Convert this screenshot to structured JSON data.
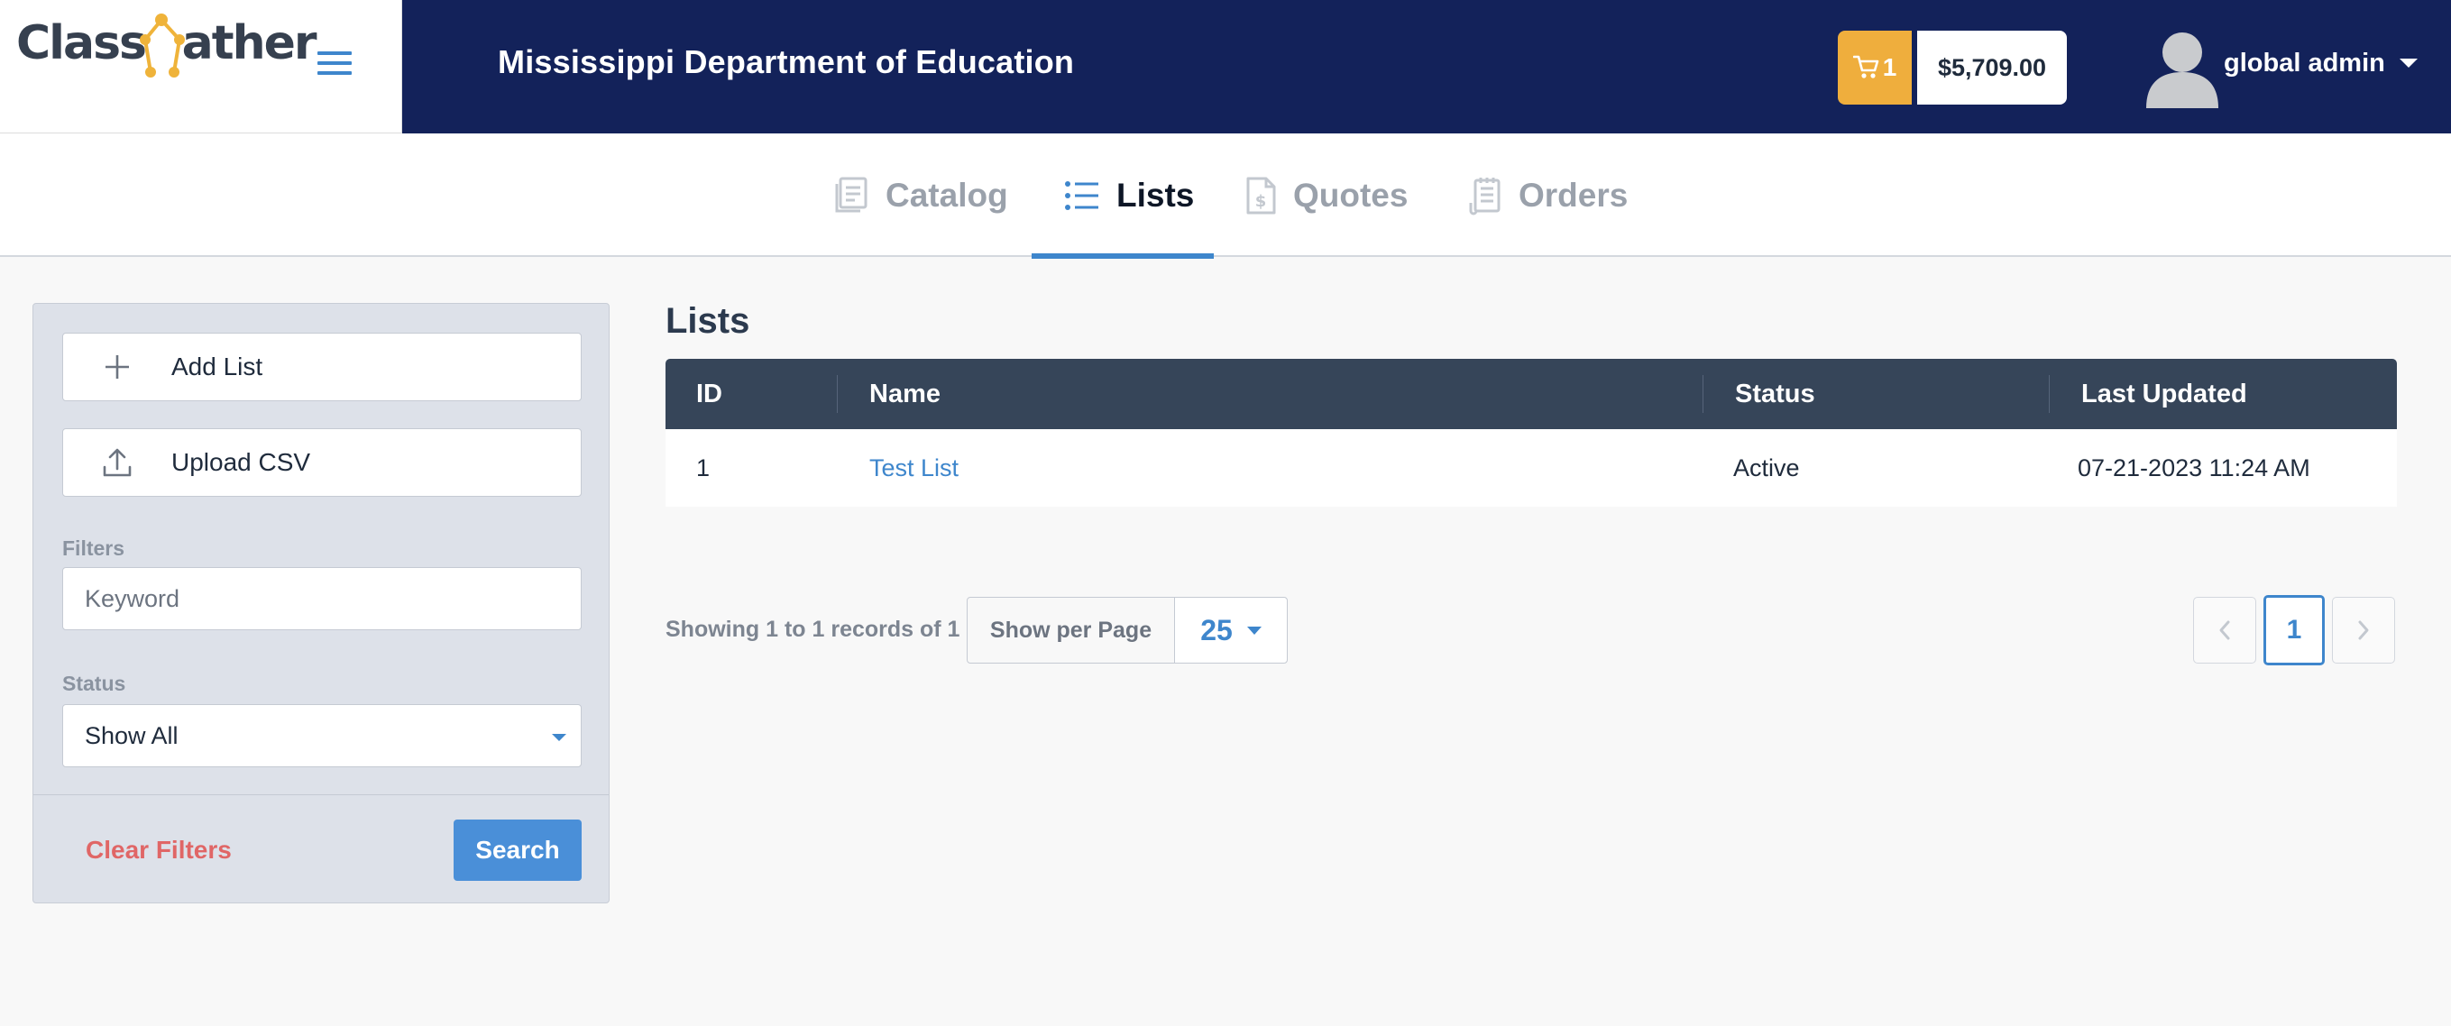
{
  "brand": {
    "logo_text_left": "Class",
    "logo_text_g": "G",
    "logo_text_right": "ather",
    "accent_color": "#efb33a",
    "header_bg": "#13225a"
  },
  "header": {
    "org_name": "Mississippi Department of Education",
    "cart_count": "1",
    "cart_total": "$5,709.00",
    "user_name": "global admin"
  },
  "nav": {
    "tabs": [
      {
        "label": "Catalog",
        "icon": "catalog-icon",
        "active": false
      },
      {
        "label": "Lists",
        "icon": "list-icon",
        "active": true
      },
      {
        "label": "Quotes",
        "icon": "quote-icon",
        "active": false
      },
      {
        "label": "Orders",
        "icon": "orders-icon",
        "active": false
      }
    ]
  },
  "sidebar": {
    "add_list_label": "Add List",
    "upload_csv_label": "Upload CSV",
    "filters_label": "Filters",
    "keyword_placeholder": "Keyword",
    "status_label": "Status",
    "status_selected": "Show All",
    "clear_filters_label": "Clear Filters",
    "search_label": "Search"
  },
  "main": {
    "title": "Lists",
    "columns": [
      "ID",
      "Name",
      "Status",
      "Last Updated"
    ],
    "rows": [
      {
        "id": "1",
        "name": "Test List",
        "status": "Active",
        "last_updated": "07-21-2023 11:24 AM"
      }
    ],
    "showing_text": "Showing 1 to 1 records of 1",
    "per_page_label": "Show per Page",
    "per_page_value": "25",
    "current_page": "1"
  }
}
